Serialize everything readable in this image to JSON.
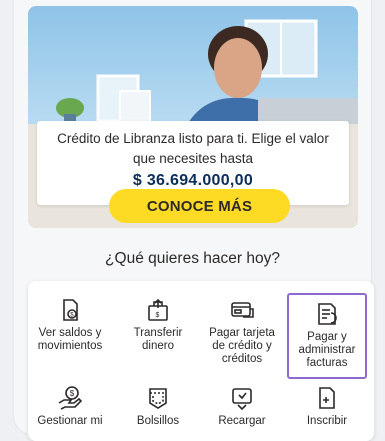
{
  "promo": {
    "text": "Crédito de Libranza listo para ti. Elige el valor que necesites hasta",
    "amount": "$ 36.694.000,00",
    "button_label": "CONOCE MÁS"
  },
  "question": "¿Qué quieres hacer hoy?",
  "actions": [
    {
      "label": "Ver saldos y movimientos",
      "icon": "wallet-icon"
    },
    {
      "label": "Transferir dinero",
      "icon": "transfer-icon"
    },
    {
      "label": "Pagar tarjeta de crédito y créditos",
      "icon": "credit-card-icon"
    },
    {
      "label": "Pagar y administrar facturas",
      "icon": "invoice-icon",
      "selected": true
    },
    {
      "label": "Gestionar mi",
      "icon": "hand-money-icon"
    },
    {
      "label": "Bolsillos",
      "icon": "pocket-icon"
    },
    {
      "label": "Recargar",
      "icon": "recharge-icon"
    },
    {
      "label": "Inscribir",
      "icon": "add-document-icon"
    }
  ],
  "colors": {
    "accent_yellow": "#fdda24",
    "amount_blue": "#0c2e5a",
    "selection_purple": "#8e6ad0"
  }
}
